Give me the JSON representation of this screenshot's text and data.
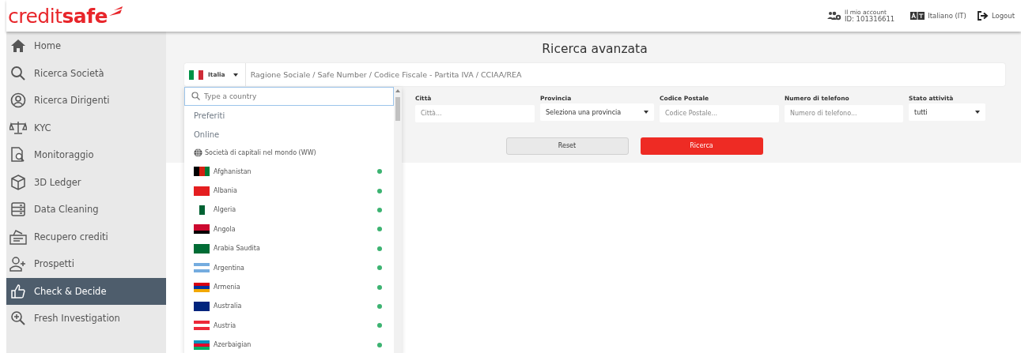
{
  "header": {
    "logo": "credit**safe**",
    "account_label": "Il mio account",
    "account_id": "ID: 101316611",
    "language": "Italiano (IT)",
    "logout": "Logout"
  },
  "sidebar": {
    "items": [
      {
        "label": "Home",
        "selected": false
      },
      {
        "label": "Ricerca Società",
        "selected": false
      },
      {
        "label": "Ricerca Dirigenti",
        "selected": false
      },
      {
        "label": "KYC",
        "selected": false
      },
      {
        "label": "Monitoraggio",
        "selected": false
      },
      {
        "label": "3D Ledger",
        "selected": false
      },
      {
        "label": "Data Cleaning",
        "selected": false
      },
      {
        "label": "Recupero crediti",
        "selected": false
      },
      {
        "label": "Prospetti",
        "selected": false
      },
      {
        "label": "Check & Decide",
        "selected": true
      },
      {
        "label": "Fresh Investigation",
        "selected": false
      }
    ]
  },
  "search": {
    "title": "Ricerca avanzata",
    "country": "Italia",
    "placeholder": "Ragione Sociale / Safe Number / Codice Fiscale - Partita IVA / CCIAA/REA",
    "filters": [
      {
        "kind": "text",
        "label": "Città",
        "placeholder": "Città..."
      },
      {
        "kind": "select",
        "label": "Provincia",
        "value": "Seleziona una provincia"
      },
      {
        "kind": "text",
        "label": "Codice Postale",
        "placeholder": "Codice Postale..."
      },
      {
        "kind": "text",
        "label": "Numero di telefono",
        "placeholder": "Numero di telefono..."
      },
      {
        "kind": "select",
        "label": "Stato attività",
        "value": "tutti"
      }
    ],
    "buttons": [
      {
        "kind": "secondary",
        "label": "Reset"
      },
      {
        "kind": "primary",
        "label": "Ricerca"
      }
    ]
  },
  "country_dropdown": {
    "placeholder": "Type a country",
    "groups": [
      "Preferiti",
      "Online"
    ],
    "worldwide": "Società di capitali nel mondo (WW)",
    "countries": [
      {
        "name": "Afghanistan",
        "online": true
      },
      {
        "name": "Albania",
        "online": true
      },
      {
        "name": "Algeria",
        "online": true
      },
      {
        "name": "Angola",
        "online": true
      },
      {
        "name": "Arabia Saudita",
        "online": true
      },
      {
        "name": "Argentina",
        "online": true
      },
      {
        "name": "Armenia",
        "online": true
      },
      {
        "name": "Australia",
        "online": true
      },
      {
        "name": "Austria",
        "online": true
      },
      {
        "name": "Azerbaigian",
        "online": true
      }
    ]
  }
}
